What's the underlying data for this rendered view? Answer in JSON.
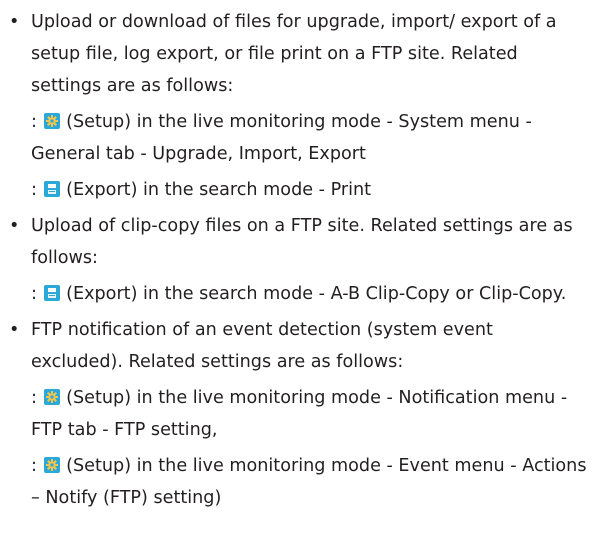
{
  "bullet_char": "•",
  "items": [
    {
      "text": "Upload or download of files for upgrade, import/ export of a setup file, log export, or file print on a FTP site. Related settings are as follows:",
      "subs": [
        {
          "prefix": ": ",
          "icon": "setup-gear-icon",
          "text": " (Setup) in the live monitoring mode - System menu - General tab - Upgrade, Import, Export"
        },
        {
          "prefix": ": ",
          "icon": "export-save-icon",
          "text": " (Export) in the search mode - Print"
        }
      ]
    },
    {
      "text": "Upload of clip-copy files on a FTP site.  Related settings are as follows:",
      "subs": [
        {
          "prefix": ": ",
          "icon": "export-save-icon",
          "text": " (Export) in the search mode - A-B Clip-Copy or Clip-Copy."
        }
      ]
    },
    {
      "text": "FTP notification of an event detection (system event excluded).  Related settings are as follows:",
      "subs": [
        {
          "prefix": ": ",
          "icon": "setup-gear-icon",
          "text": " (Setup) in the live monitoring mode - Notification menu - FTP tab - FTP setting,"
        },
        {
          "prefix": ": ",
          "icon": "setup-gear-icon",
          "text": " (Setup) in the live monitoring mode - Event menu - Actions – Notify (FTP) setting)"
        }
      ]
    }
  ],
  "colors": {
    "text": "#231f20",
    "icon_bg": "#2aa8d8",
    "gear": "#f3c64b"
  }
}
